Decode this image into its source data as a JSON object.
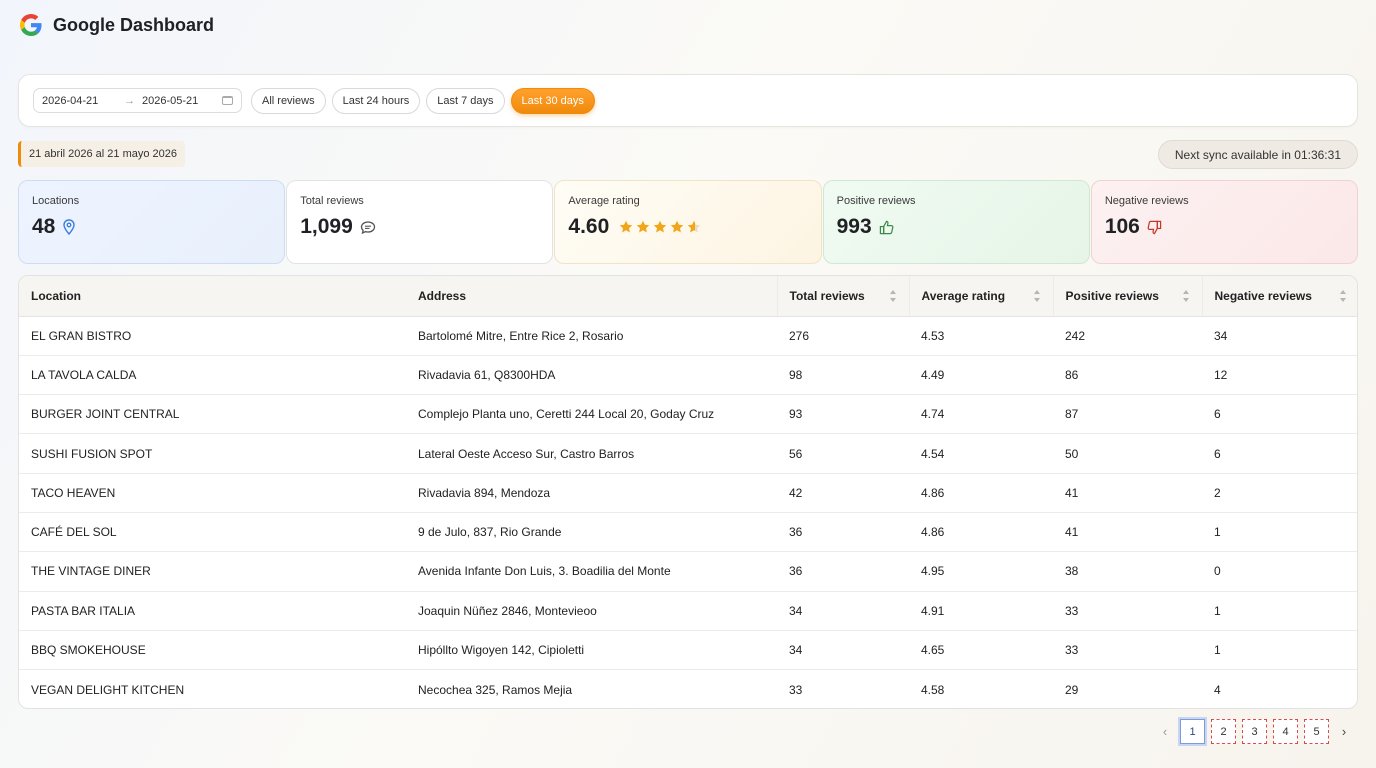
{
  "app": {
    "title": "Google Dashboard"
  },
  "filters": {
    "date_from": "2026-04-21",
    "date_to": "2026-05-21",
    "arrow": "→",
    "presets": [
      "All reviews",
      "Last 24 hours",
      "Last 7 days",
      "Last 30 days"
    ],
    "active_preset": "Last 30 days"
  },
  "period_label": "21 abril 2026 al 21 mayo 2026",
  "sync_status": "Next sync available in 01:36:31",
  "stats": {
    "locations": {
      "label": "Locations",
      "value": "48"
    },
    "total_reviews": {
      "label": "Total reviews",
      "value": "1,099"
    },
    "average_rating": {
      "label": "Average rating",
      "value": "4.60",
      "stars": 4.6
    },
    "positive_reviews": {
      "label": "Positive reviews",
      "value": "993"
    },
    "negative_reviews": {
      "label": "Negative reviews",
      "value": "106"
    }
  },
  "table": {
    "columns": [
      "Location",
      "Address",
      "Total reviews",
      "Average rating",
      "Positive reviews",
      "Negative reviews"
    ],
    "rows": [
      [
        "EL GRAN BISTRO",
        "Bartolomé Mitre, Entre Rice 2, Rosario",
        "276",
        "4.53",
        "242",
        "34"
      ],
      [
        "LA TAVOLA CALDA",
        "Rivadavia 61, Q8300HDA",
        "98",
        "4.49",
        "86",
        "12"
      ],
      [
        "BURGER JOINT CENTRAL",
        "Complejo Planta uno, Ceretti 244 Local 20, Goday Cruz",
        "93",
        "4.74",
        "87",
        "6"
      ],
      [
        "SUSHI FUSION SPOT",
        "Lateral Oeste Acceso Sur, Castro Barros",
        "56",
        "4.54",
        "50",
        "6"
      ],
      [
        "TACO HEAVEN",
        "Rivadavia 894, Mendoza",
        "42",
        "4.86",
        "41",
        "2"
      ],
      [
        "CAFÉ DEL SOL",
        "9 de Julo, 837, Rio Grande",
        "36",
        "4.86",
        "41",
        "1"
      ],
      [
        "THE VINTAGE DINER",
        "Avenida Infante Don Luis, 3. Boadilia del Monte",
        "36",
        "4.95",
        "38",
        "0"
      ],
      [
        "PASTA BAR ITALIA",
        "Joaquin Nüñez 2846, Montevieoo",
        "34",
        "4.91",
        "33",
        "1"
      ],
      [
        "BBQ SMOKEHOUSE",
        "Hipóllto Wigoyen 142, Cipioletti",
        "34",
        "4.65",
        "33",
        "1"
      ],
      [
        "VEGAN DELIGHT KITCHEN",
        "Necochea 325, Ramos Mejia",
        "33",
        "4.58",
        "29",
        "4"
      ]
    ]
  },
  "pagination": {
    "pages": [
      "1",
      "2",
      "3",
      "4",
      "5"
    ],
    "current": "1",
    "prev_label": "‹",
    "next_label": "›"
  },
  "colors": {
    "accent": "#f08a0b",
    "star": "#f2a516",
    "positive": "#3b8a4a",
    "negative": "#c0392b",
    "location_pin": "#3b7ddd"
  }
}
